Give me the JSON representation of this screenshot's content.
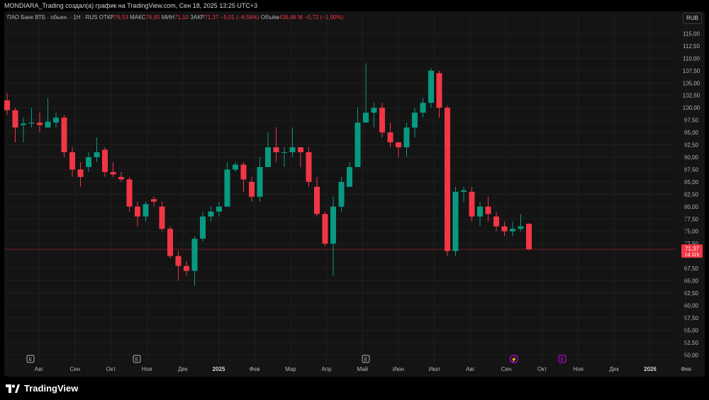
{
  "title": "MONDIARA_Trading создал(а) график на TradingView.com, Сен 18, 2025 13:25 UTC+3",
  "legend": {
    "symbol": "ПАО Банк ВТБ · обыкн. · 1Н · RUS",
    "open_label": "ОТКР",
    "open_value": "76,53",
    "high_label": "МАКС",
    "high_value": "76,65",
    "low_label": "МИН",
    "low_value": "71,10",
    "close_label": "ЗАКР",
    "close_value": "71,37",
    "change": "−5,01 (−6,56%)",
    "volume_label": "Объём",
    "volume_value": "436,46 M",
    "volume_change": "−0,72 (−1,00%)"
  },
  "currency": "RUB",
  "price_badge": {
    "price": "71,37",
    "countdown": "1d 11h"
  },
  "brand": "TradingView",
  "colors": {
    "up": "#089981",
    "down": "#f23645",
    "background": "#141414",
    "grid": "#1f1f1f",
    "event_earnings": "#b2b5be",
    "event_future": "#d500f9"
  },
  "chart_data": {
    "type": "candlestick",
    "ylim": [
      48.75,
      117.5
    ],
    "y_ticks": [
      "115,00",
      "112,50",
      "110,00",
      "107,50",
      "105,00",
      "102,50",
      "100,00",
      "97,50",
      "95,00",
      "92,50",
      "90,00",
      "87,50",
      "85,00",
      "82,50",
      "80,00",
      "77,50",
      "75,00",
      "72,50",
      "67,50",
      "65,00",
      "62,50",
      "60,00",
      "57,50",
      "55,00",
      "52,50",
      "50,00"
    ],
    "x_labels": [
      {
        "label": "Авг",
        "bold": false
      },
      {
        "label": "Сен",
        "bold": false
      },
      {
        "label": "Окт",
        "bold": false
      },
      {
        "label": "Ноя",
        "bold": false
      },
      {
        "label": "Дек",
        "bold": false
      },
      {
        "label": "2025",
        "bold": true
      },
      {
        "label": "Фев",
        "bold": false
      },
      {
        "label": "Мар",
        "bold": false
      },
      {
        "label": "Апр",
        "bold": false
      },
      {
        "label": "Май",
        "bold": false
      },
      {
        "label": "Июн",
        "bold": false
      },
      {
        "label": "Июл",
        "bold": false
      },
      {
        "label": "Авг",
        "bold": false
      },
      {
        "label": "Сен",
        "bold": false
      },
      {
        "label": "Окт",
        "bold": false
      },
      {
        "label": "Ноя",
        "bold": false
      },
      {
        "label": "Дек",
        "bold": false
      },
      {
        "label": "2026",
        "bold": true
      },
      {
        "label": "Фев",
        "bold": false
      }
    ],
    "last_price": 71.37,
    "candles": [
      [
        101.5,
        99.5,
        103,
        98.5
      ],
      [
        99.5,
        96,
        100,
        93
      ],
      [
        96.5,
        96.8,
        98,
        93
      ],
      [
        96.8,
        97,
        100,
        96
      ],
      [
        97,
        96.5,
        99,
        95
      ],
      [
        96,
        97.2,
        102,
        96
      ],
      [
        97,
        98,
        99,
        96
      ],
      [
        98,
        91,
        98.5,
        90
      ],
      [
        91,
        87.5,
        92,
        86
      ],
      [
        87.5,
        86,
        89,
        84
      ],
      [
        88,
        90,
        91,
        87
      ],
      [
        90,
        91,
        94,
        89
      ],
      [
        91.5,
        87,
        92,
        86
      ],
      [
        87,
        86.5,
        89,
        86
      ],
      [
        86,
        85.5,
        87,
        85
      ],
      [
        85.5,
        80,
        86,
        79
      ],
      [
        80,
        78,
        81,
        76
      ],
      [
        78,
        80.5,
        81,
        77
      ],
      [
        81.5,
        81,
        82,
        80
      ],
      [
        80,
        75.5,
        81,
        75
      ],
      [
        75.5,
        70,
        76,
        69.5
      ],
      [
        70,
        68,
        71,
        65
      ],
      [
        68,
        67,
        69,
        66
      ],
      [
        67,
        73.5,
        74,
        64
      ],
      [
        73.5,
        78,
        79,
        73
      ],
      [
        78,
        79,
        80,
        77
      ],
      [
        79,
        80,
        81,
        78
      ],
      [
        80,
        87.5,
        89,
        80
      ],
      [
        87.5,
        88.5,
        89,
        87
      ],
      [
        88.5,
        85.5,
        89,
        83
      ],
      [
        85,
        82,
        86,
        81
      ],
      [
        82,
        88,
        90,
        81
      ],
      [
        88,
        92,
        95,
        88
      ],
      [
        92,
        91,
        96,
        89
      ],
      [
        91,
        91,
        92,
        88
      ],
      [
        91,
        92,
        96,
        90
      ],
      [
        92,
        91,
        92,
        88
      ],
      [
        91,
        85,
        92,
        84
      ],
      [
        84,
        78.5,
        86,
        78
      ],
      [
        78.5,
        72.5,
        79,
        72
      ],
      [
        72.5,
        80,
        82,
        66
      ],
      [
        80,
        85,
        86,
        79
      ],
      [
        84,
        88,
        89,
        84
      ],
      [
        88,
        97,
        100,
        88
      ],
      [
        97,
        99,
        109,
        97
      ],
      [
        99,
        100,
        101,
        96
      ],
      [
        100,
        95,
        101,
        94
      ],
      [
        95,
        93,
        97,
        92
      ],
      [
        93,
        92,
        93,
        90
      ],
      [
        92,
        96,
        97,
        90
      ],
      [
        96,
        99,
        100,
        94
      ],
      [
        99,
        101,
        102,
        98
      ],
      [
        101,
        107.5,
        108,
        100
      ],
      [
        107,
        100,
        107.5,
        98
      ],
      [
        100,
        71,
        100.5,
        70
      ],
      [
        71,
        83,
        84,
        70
      ],
      [
        83,
        83.3,
        84,
        81
      ],
      [
        83,
        78,
        84,
        77
      ],
      [
        78,
        80,
        81,
        76
      ],
      [
        80,
        78.5,
        82,
        77
      ],
      [
        78,
        76,
        79,
        75
      ],
      [
        76,
        75,
        77,
        74
      ],
      [
        75,
        75.5,
        77,
        74
      ],
      [
        75.5,
        76,
        78.5,
        75
      ],
      [
        76.53,
        71.37,
        76.65,
        71.1
      ]
    ],
    "event_markers": [
      {
        "type": "earnings",
        "label": "E"
      },
      {
        "type": "earnings",
        "label": "E"
      },
      {
        "type": "earnings",
        "label": "E"
      },
      {
        "type": "dividend",
        "label": "⚡"
      },
      {
        "type": "earnings-future",
        "label": "E"
      }
    ]
  }
}
